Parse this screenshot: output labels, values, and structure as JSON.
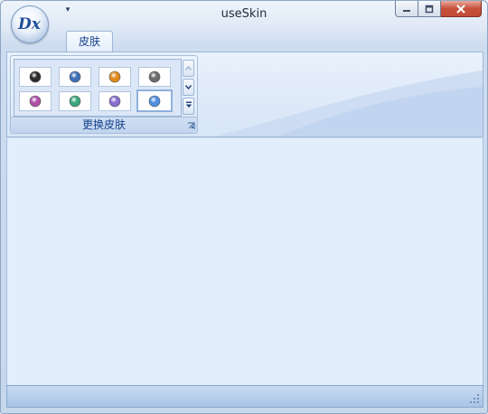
{
  "window": {
    "title": "useSkin"
  },
  "app_button": {
    "logo_text": "Dx"
  },
  "qat": {
    "customize_glyph": "▾"
  },
  "tabs": [
    {
      "label": "皮肤"
    }
  ],
  "ribbon": {
    "groups": [
      {
        "label": "更换皮肤",
        "gallery_items": [
          {
            "name": "skin-black",
            "icon": "black-sphere",
            "color": "#2b2b2b"
          },
          {
            "name": "skin-blue",
            "icon": "blue-sphere",
            "color": "#3f6fb8"
          },
          {
            "name": "skin-orange",
            "icon": "orange-sphere",
            "color": "#e08a1e"
          },
          {
            "name": "skin-gray",
            "icon": "gray-sphere",
            "color": "#6a6a6a"
          },
          {
            "name": "skin-purple-pink",
            "icon": "purple-sphere",
            "color": "#b04fa8"
          },
          {
            "name": "skin-teal-green",
            "icon": "teal-sphere",
            "color": "#3aa77f"
          },
          {
            "name": "skin-violet",
            "icon": "violet-sphere",
            "color": "#8a6ed0"
          },
          {
            "name": "skin-office-blue",
            "icon": "blue-sphere",
            "color": "#4f8ee0",
            "selected": true
          }
        ]
      }
    ]
  },
  "colors": {
    "accent": "#15428b",
    "frame": "#8ea6c4",
    "content_bg": "#e2eefc",
    "close": "#c7503b"
  }
}
